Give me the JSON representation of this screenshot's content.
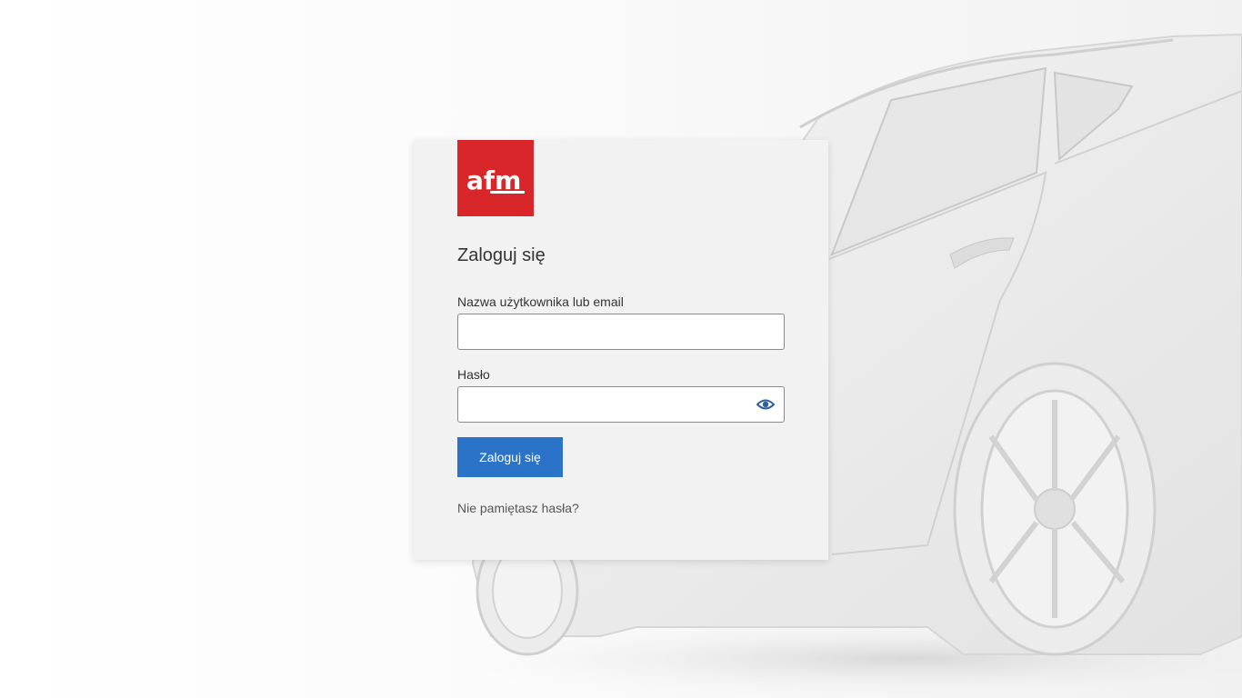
{
  "brand": {
    "logo_text": "afm",
    "logo_color": "#d9262a"
  },
  "login": {
    "title": "Zaloguj się",
    "username_label": "Nazwa użytkownika lub email",
    "username_value": "",
    "password_label": "Hasło",
    "password_value": "",
    "show_password_icon": "eye-icon",
    "submit_label": "Zaloguj się",
    "forgot_link": "Nie pamiętasz hasła?"
  },
  "colors": {
    "accent": "#2b72c9",
    "card_background": "#f2f2f2",
    "page_background": "#ffffff"
  },
  "background": {
    "image": "car-photo"
  }
}
